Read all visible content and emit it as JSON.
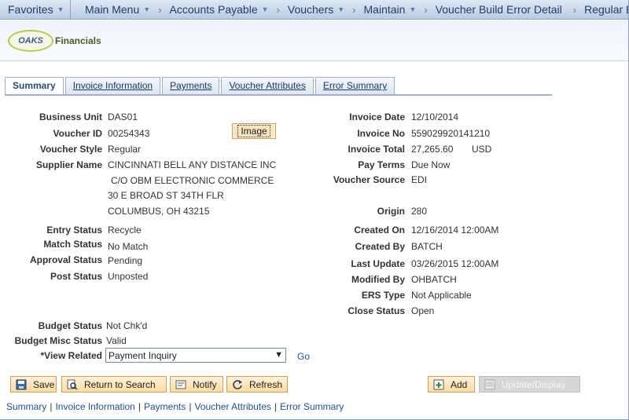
{
  "nav": {
    "favorites": "Favorites",
    "crumbs": [
      "Main Menu",
      "Accounts Payable",
      "Vouchers",
      "Maintain",
      "Voucher Build Error Detail",
      "Regular Entry"
    ]
  },
  "logo": {
    "oval_text": "OAKS",
    "text": "Financials"
  },
  "tabs": [
    "Summary",
    "Invoice Information",
    "Payments",
    "Voucher Attributes",
    "Error Summary"
  ],
  "left": {
    "business_unit_label": "Business Unit",
    "business_unit": "DAS01",
    "voucher_id_label": "Voucher ID",
    "voucher_id": "00254343",
    "voucher_style_label": "Voucher Style",
    "voucher_style": "Regular",
    "supplier_name_label": "Supplier Name",
    "supplier_lines": [
      "CINCINNATI BELL ANY DISTANCE INC",
      "C/O OBM ELECTRONIC COMMERCE",
      "30 E BROAD ST 34TH FLR",
      "COLUMBUS, OH  43215"
    ],
    "entry_status_label": "Entry Status",
    "entry_status": "Recycle",
    "match_status_label": "Match Status",
    "match_status": "No Match",
    "approval_status_label": "Approval Status",
    "approval_status": "Pending",
    "post_status_label": "Post Status",
    "post_status": "Unposted",
    "budget_status_label": "Budget Status",
    "budget_status": "Not Chk'd",
    "budget_misc_label": "Budget Misc Status",
    "budget_misc": "Valid",
    "view_related_label": "*View Related",
    "view_related": "Payment Inquiry",
    "go": "Go",
    "image_button": "Image"
  },
  "right": {
    "invoice_date_label": "Invoice Date",
    "invoice_date": "12/10/2014",
    "invoice_no_label": "Invoice No",
    "invoice_no": "559029920141210",
    "invoice_total_label": "Invoice Total",
    "invoice_total": "27,265.60",
    "currency": "USD",
    "pay_terms_label": "Pay Terms",
    "pay_terms": "Due Now",
    "voucher_source_label": "Voucher Source",
    "voucher_source": "EDI",
    "origin_label": "Origin",
    "origin": "280",
    "created_on_label": "Created On",
    "created_on": "12/16/2014 12:00AM",
    "created_by_label": "Created By",
    "created_by": "BATCH",
    "last_update_label": "Last Update",
    "last_update": "03/26/2015 12:00AM",
    "modified_by_label": "Modified By",
    "modified_by": "OHBATCH",
    "ers_type_label": "ERS Type",
    "ers_type": "Not Applicable",
    "close_status_label": "Close Status",
    "close_status": "Open"
  },
  "toolbar": {
    "save": "Save",
    "return": "Return to Search",
    "notify": "Notify",
    "refresh": "Refresh",
    "add": "Add",
    "update": "Update/Display"
  },
  "bottom_links": [
    "Summary",
    "Invoice Information",
    "Payments",
    "Voucher Attributes",
    "Error Summary"
  ]
}
